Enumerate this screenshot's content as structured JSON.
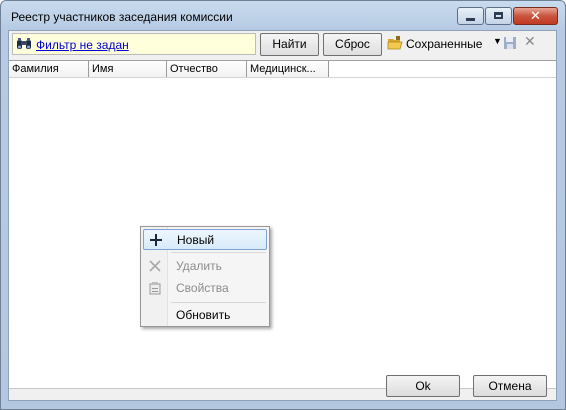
{
  "window": {
    "title": "Реестр участников заседания комиссии"
  },
  "filter": {
    "text": "Фильтр не задан"
  },
  "toolbar": {
    "find_label": "Найти",
    "reset_label": "Сброс",
    "saved_label": "Сохраненные",
    "delete_symbol": "✕"
  },
  "grid": {
    "columns": [
      "Фамилия",
      "Имя",
      "Отчество",
      "Медицинск..."
    ]
  },
  "context_menu": {
    "items": [
      {
        "label": "Новый",
        "icon": "plus-icon",
        "enabled": true
      },
      {
        "label": "Удалить",
        "icon": "delete-icon",
        "enabled": false
      },
      {
        "label": "Свойства",
        "icon": "properties-icon",
        "enabled": false
      },
      {
        "label": "Обновить",
        "icon": "",
        "enabled": true
      }
    ]
  },
  "dialog": {
    "ok_label": "Ok",
    "cancel_label": "Отмена"
  }
}
